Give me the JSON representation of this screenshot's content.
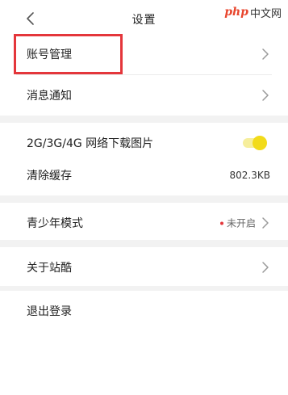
{
  "header": {
    "title": "设置",
    "back_icon": "chevron-left-icon"
  },
  "watermark": {
    "brand": "php",
    "text": "中文网"
  },
  "settings": {
    "account_management": "账号管理",
    "notifications": "消息通知",
    "mobile_image_download": "2G/3G/4G 网络下载图片",
    "mobile_image_download_enabled": true,
    "clear_cache": "清除缓存",
    "cache_size": "802.3KB",
    "youth_mode": "青少年模式",
    "youth_mode_status": "未开启",
    "about": "关于站酷",
    "logout": "退出登录"
  },
  "colors": {
    "highlight": "#e4363b",
    "toggle_on": "#f2db1a",
    "status_dot": "#e4363b",
    "watermark_brand": "#e8452d",
    "section_gap": "#f2f2f2"
  }
}
